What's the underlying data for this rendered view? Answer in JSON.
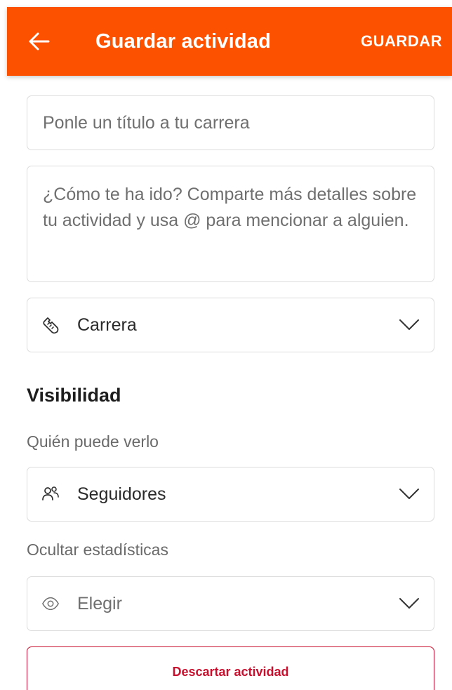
{
  "colors": {
    "accent": "#fc5200",
    "danger": "#c8102e",
    "border": "#dcdcdc",
    "muted_text": "#6f6f6f"
  },
  "appbar": {
    "back_icon": "arrow-left-icon",
    "title": "Guardar actividad",
    "save_label": "GUARDAR"
  },
  "form": {
    "title_placeholder": "Ponle un título a tu carrera",
    "description_placeholder": "¿Cómo te ha ido? Comparte más detalles sobre tu actividad y usa @ para mencionar a alguien.",
    "sport": {
      "icon": "running-shoe-icon",
      "value": "Carrera"
    }
  },
  "visibility": {
    "heading": "Visibilidad",
    "who_label": "Quién puede verlo",
    "who": {
      "icon": "followers-icon",
      "value": "Seguidores"
    },
    "hide_stats_label": "Ocultar estadísticas",
    "hide_stats": {
      "icon": "eye-icon",
      "value": "Elegir"
    }
  },
  "actions": {
    "discard_label": "Descartar actividad"
  }
}
